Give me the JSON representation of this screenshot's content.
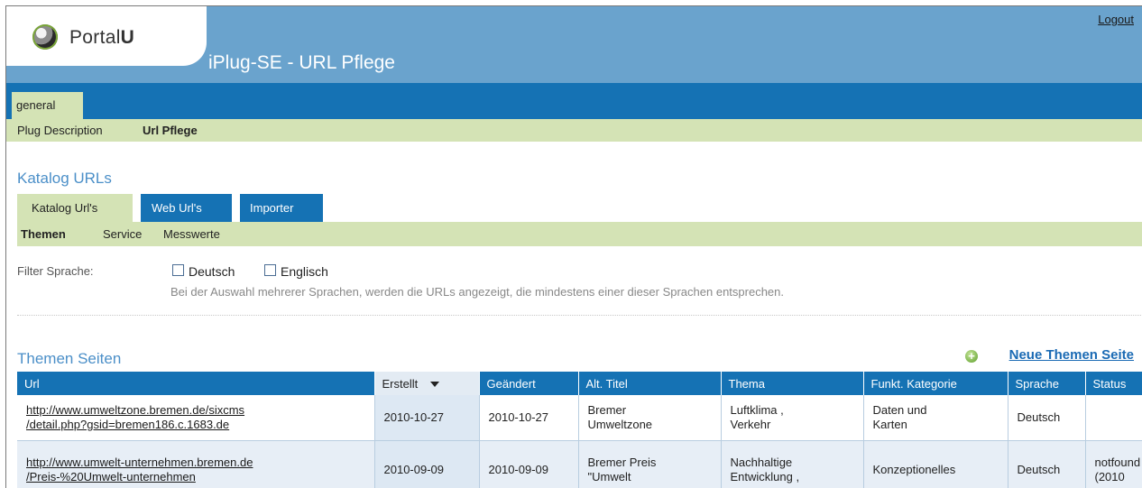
{
  "header": {
    "logo_text_light": "Portal",
    "logo_text_bold": "U",
    "app_title": "iPlug-SE - URL Pflege",
    "logout": "Logout"
  },
  "main_tabs": [
    {
      "label": "general"
    }
  ],
  "subnav": {
    "plug_description": "Plug Description",
    "url_pflege": "Url Pflege"
  },
  "section": {
    "title": "Katalog URLs",
    "tabs": [
      {
        "label": "Katalog Url's"
      },
      {
        "label": "Web Url's"
      },
      {
        "label": "Importer"
      }
    ],
    "subtabs": [
      {
        "label": "Themen"
      },
      {
        "label": "Service"
      },
      {
        "label": "Messwerte"
      }
    ]
  },
  "filter": {
    "label": "Filter Sprache:",
    "options": [
      {
        "label": "Deutsch"
      },
      {
        "label": "Englisch"
      }
    ],
    "hint": "Bei der Auswahl mehrerer Sprachen, werden die URLs angezeigt, die mindestens einer dieser Sprachen entsprechen."
  },
  "table_section": {
    "title": "Themen Seiten",
    "new_link": "Neue Themen Seite"
  },
  "table": {
    "columns": [
      "Url",
      "Erstellt",
      "Geändert",
      "Alt. Titel",
      "Thema",
      "Funkt. Kategorie",
      "Sprache",
      "Status"
    ],
    "rows": [
      {
        "url_line1": "http://www.umweltzone.bremen.de/sixcms",
        "url_line2": "/detail.php?gsid=bremen186.c.1683.de",
        "erstellt": "2010-10-27",
        "geaendert": "2010-10-27",
        "alt_titel_line1": "Bremer",
        "alt_titel_line2": "Umweltzone",
        "thema_line1": "Luftklima ,",
        "thema_line2": "Verkehr",
        "kategorie_line1": "Daten und",
        "kategorie_line2": "Karten",
        "sprache": "Deutsch",
        "status_line1": "",
        "status_line2": ""
      },
      {
        "url_line1": "http://www.umwelt-unternehmen.bremen.de",
        "url_line2": "/Preis-%20Umwelt-unternehmen",
        "erstellt": "2010-09-09",
        "geaendert": "2010-09-09",
        "alt_titel_line1": "Bremer Preis",
        "alt_titel_line2": "\"Umwelt",
        "thema_line1": "Nachhaltige",
        "thema_line2": "Entwicklung ,",
        "kategorie_line1": "Konzeptionelles",
        "kategorie_line2": "",
        "sprache": "Deutsch",
        "status_line1": "notfound",
        "status_line2": "(2010"
      }
    ]
  },
  "colors": {
    "header_bg": "#6aa3cd",
    "nav_blue": "#1572b4",
    "nav_green": "#d4e3b5",
    "title_blue": "#4b8fc8"
  }
}
